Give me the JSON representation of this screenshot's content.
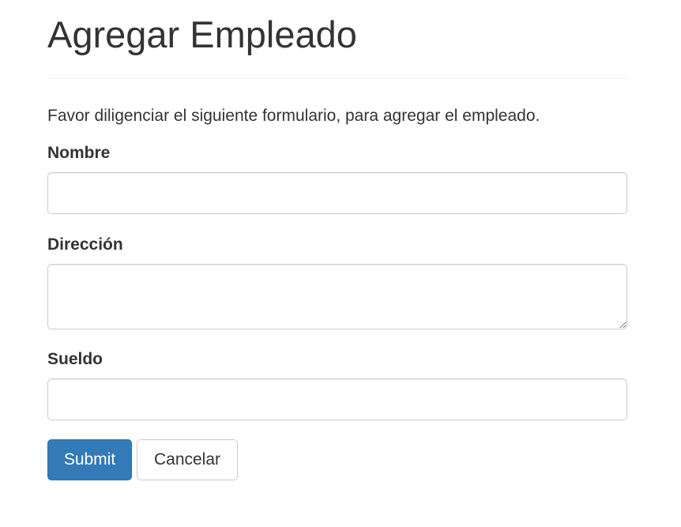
{
  "page": {
    "title": "Agregar Empleado",
    "intro": "Favor diligenciar el siguiente formulario, para agregar el empleado."
  },
  "form": {
    "nombre": {
      "label": "Nombre",
      "value": ""
    },
    "direccion": {
      "label": "Dirección",
      "value": ""
    },
    "sueldo": {
      "label": "Sueldo",
      "value": ""
    }
  },
  "actions": {
    "submit_label": "Submit",
    "cancel_label": "Cancelar"
  },
  "colors": {
    "primary": "#337ab7",
    "text": "#333333",
    "border": "#cccccc"
  }
}
